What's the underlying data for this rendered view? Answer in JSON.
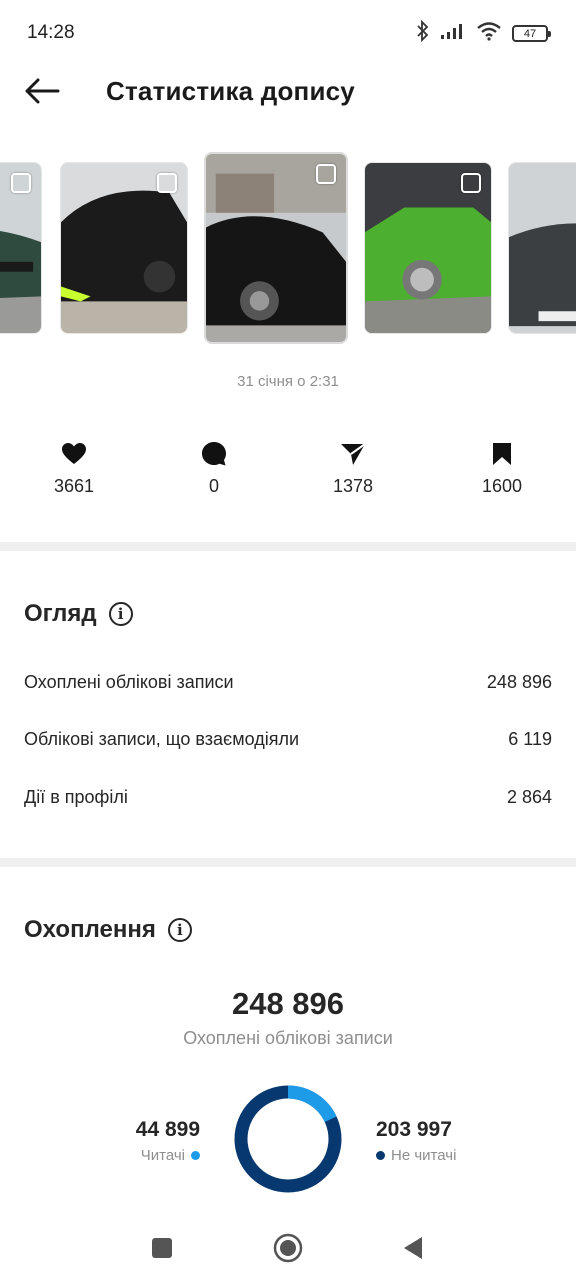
{
  "status_bar": {
    "time": "14:28",
    "battery": "47",
    "icons": [
      "bluetooth-icon",
      "signal-icon",
      "wifi-icon",
      "battery-icon"
    ]
  },
  "header": {
    "back_icon": "arrow-left-icon",
    "title": "Статистика допису"
  },
  "carousel": {
    "items": [
      {
        "name": "car-photo-1",
        "color": "#2f4a3e"
      },
      {
        "name": "car-photo-2",
        "color": "#1b1b1b"
      },
      {
        "name": "car-photo-3",
        "color": "#151515"
      },
      {
        "name": "car-photo-4",
        "color": "#4caf2f"
      },
      {
        "name": "car-photo-5",
        "color": "#3c3f42"
      }
    ]
  },
  "post": {
    "date": "31 січня о 2:31"
  },
  "stats": {
    "likes": "3661",
    "comments": "0",
    "shares": "1378",
    "saves": "1600"
  },
  "overview": {
    "title": "Огляд",
    "rows": [
      {
        "label": "Охоплені облікові записи",
        "value": "248 896"
      },
      {
        "label": "Облікові записи, що взаємодіяли",
        "value": "6 119"
      },
      {
        "label": "Дії в профілі",
        "value": "2 864"
      }
    ]
  },
  "reach": {
    "title": "Охоплення",
    "total": "248 896",
    "total_label": "Охоплені облікові записи",
    "followers_value": "44 899",
    "followers_label": "Читачі",
    "non_followers_value": "203 997",
    "non_followers_label": "Не читачі",
    "followers_color": "#1e9be8",
    "non_followers_color": "#073870"
  },
  "chart_data": {
    "type": "pie",
    "categories": [
      "Читачі",
      "Не читачі"
    ],
    "values": [
      44899,
      203997
    ]
  }
}
